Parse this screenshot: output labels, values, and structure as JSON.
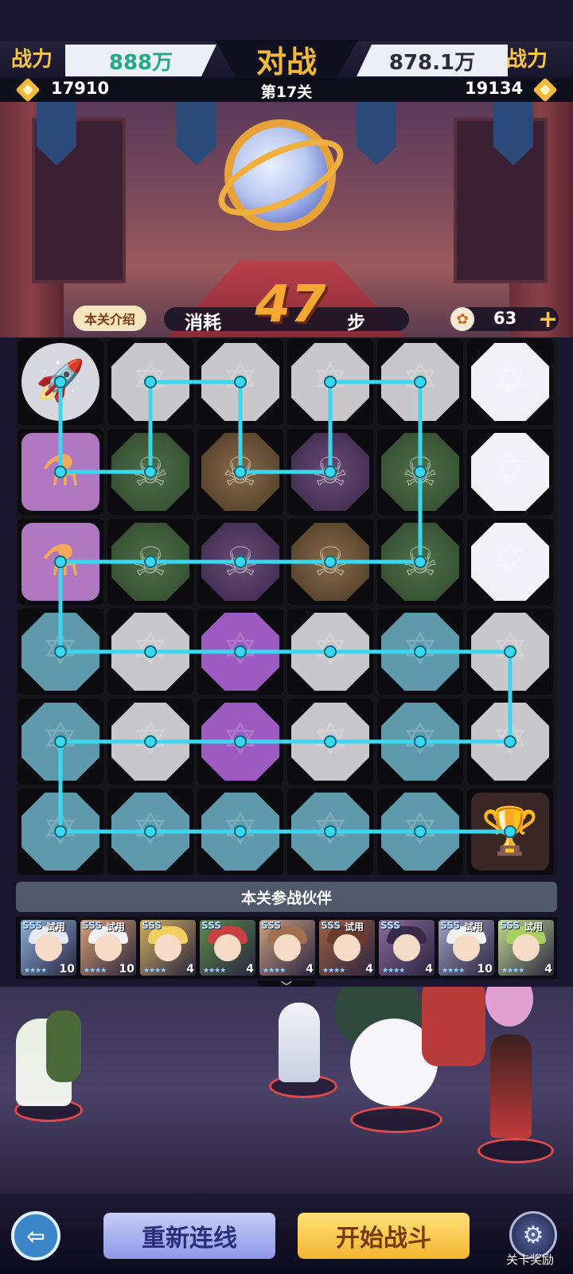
{
  "header": {
    "left_power_label": "战力",
    "left_power_value": "888万",
    "title": "对战",
    "right_power_value": "878.1万",
    "right_power_label": "战力",
    "left_score": "17910",
    "level": "第17关",
    "right_score": "19134"
  },
  "steps": {
    "intro_button": "本关介绍",
    "consume_label": "消耗",
    "count": "47",
    "unit": "步"
  },
  "energy": {
    "value": "63"
  },
  "board": {
    "rows": 6,
    "cols": 6,
    "tiles": [
      [
        "rocket",
        "gray",
        "gray",
        "gray",
        "gray",
        "white"
      ],
      [
        "potion",
        "slime",
        "slime-orange",
        "slime-purple",
        "slime",
        "white"
      ],
      [
        "potion",
        "slime",
        "slime-purple",
        "slime-orange",
        "slime",
        "white"
      ],
      [
        "teal",
        "gray",
        "purple",
        "gray",
        "teal",
        "gray"
      ],
      [
        "teal",
        "gray",
        "purple",
        "gray",
        "teal",
        "gray"
      ],
      [
        "teal",
        "teal",
        "teal",
        "teal",
        "teal",
        "trophy"
      ]
    ],
    "path_color": "#39d8f0",
    "path": [
      [
        0,
        0
      ],
      [
        1,
        0
      ],
      [
        1,
        1
      ],
      [
        0,
        1
      ],
      [
        0,
        2
      ],
      [
        1,
        2
      ],
      [
        1,
        3
      ],
      [
        0,
        3
      ],
      [
        0,
        4
      ],
      [
        1,
        4
      ],
      [
        2,
        4
      ],
      [
        2,
        3
      ],
      [
        2,
        2
      ],
      [
        2,
        1
      ],
      [
        2,
        0
      ],
      [
        3,
        0
      ],
      [
        3,
        1
      ],
      [
        3,
        2
      ],
      [
        3,
        3
      ],
      [
        3,
        4
      ],
      [
        3,
        5
      ],
      [
        4,
        5
      ],
      [
        4,
        4
      ],
      [
        4,
        3
      ],
      [
        4,
        2
      ],
      [
        4,
        1
      ],
      [
        4,
        0
      ],
      [
        5,
        0
      ],
      [
        5,
        1
      ],
      [
        5,
        2
      ],
      [
        5,
        3
      ],
      [
        5,
        4
      ],
      [
        5,
        5
      ]
    ]
  },
  "partners": {
    "title": "本关参战伙伴",
    "heroes": [
      {
        "grade": "SSS",
        "trial": "试用",
        "level": "10",
        "hair": "#e8e8f0",
        "bg": "#8ab0d8"
      },
      {
        "grade": "SSS",
        "trial": "试用",
        "level": "10",
        "hair": "#f0f0f0",
        "bg": "#d8a070"
      },
      {
        "grade": "SSS",
        "trial": "",
        "level": "4",
        "hair": "#f0d060",
        "bg": "#d0b060"
      },
      {
        "grade": "SSS",
        "trial": "",
        "level": "4",
        "hair": "#c84040",
        "bg": "#5a8a4a"
      },
      {
        "grade": "SSS",
        "trial": "",
        "level": "4",
        "hair": "#a07050",
        "bg": "#c8a080"
      },
      {
        "grade": "SSS",
        "trial": "试用",
        "level": "4",
        "hair": "#6a3a2a",
        "bg": "#a06040"
      },
      {
        "grade": "SSS",
        "trial": "",
        "level": "4",
        "hair": "#3a2a4a",
        "bg": "#8a6a9a"
      },
      {
        "grade": "SSS",
        "trial": "试用",
        "level": "10",
        "hair": "#f0f0f0",
        "bg": "#a0a0c0"
      },
      {
        "grade": "SSS",
        "trial": "试用",
        "level": "4",
        "hair": "#a8d060",
        "bg": "#c0d890"
      }
    ]
  },
  "buttons": {
    "relink": "重新连线",
    "start": "开始战斗",
    "reward_label": "关卡奖励"
  }
}
